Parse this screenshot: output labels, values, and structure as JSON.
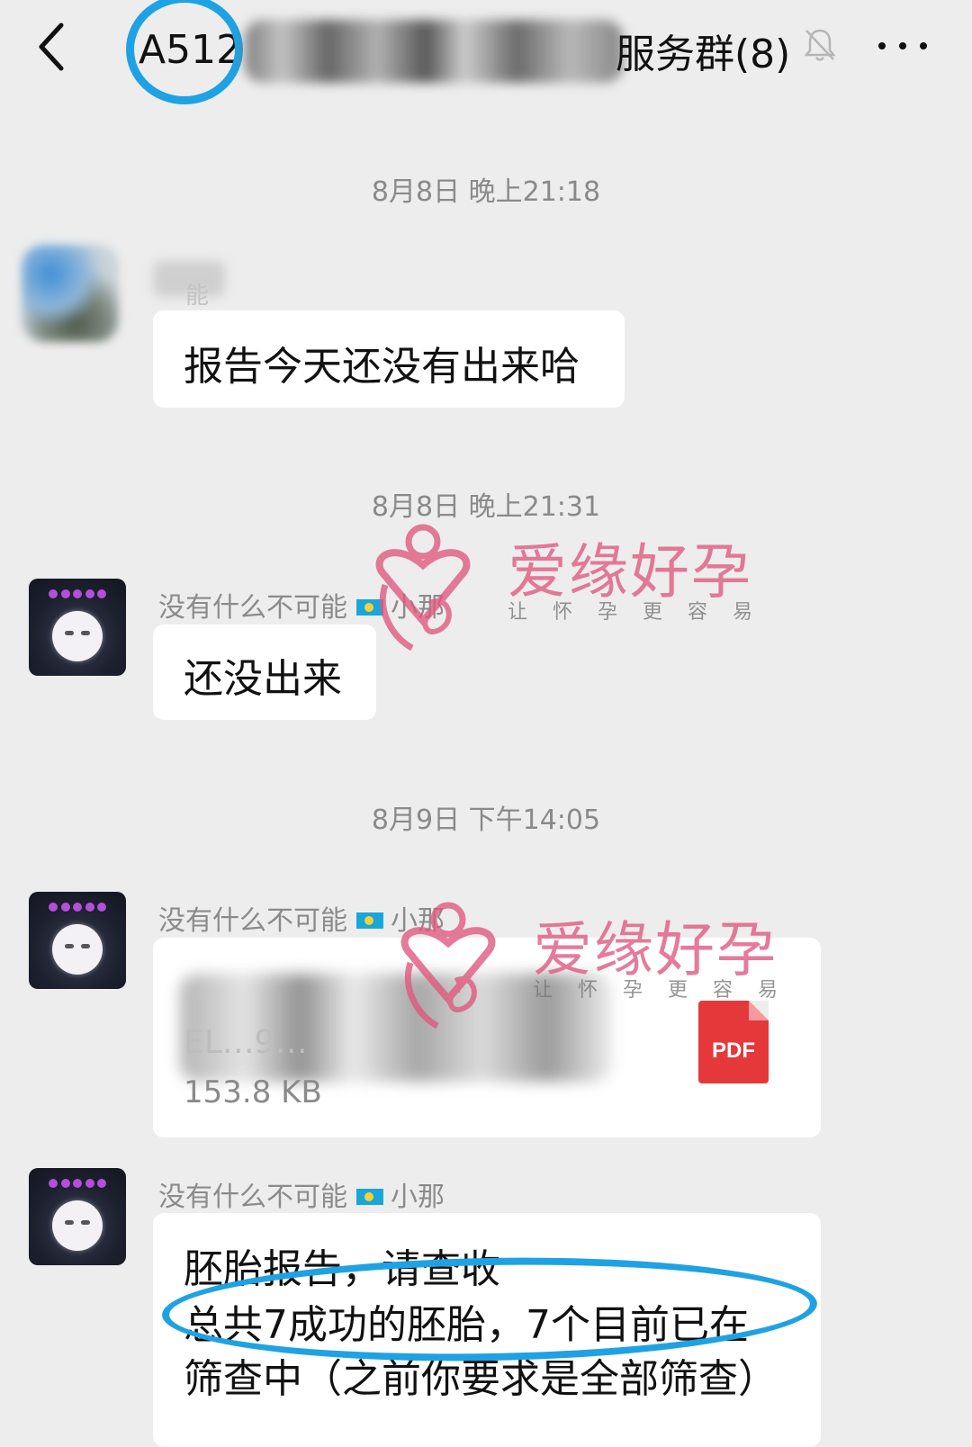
{
  "header": {
    "title_prefix": "A512",
    "title_suffix": "服务群(8)",
    "back_icon": "chevron-left-icon",
    "mute_icon": "bell-off-icon",
    "more_icon": "more-dots-icon"
  },
  "timestamps": [
    "8月8日 晚上21:18",
    "8月8日 晚上21:31",
    "8月9日 下午14:05"
  ],
  "messages": [
    {
      "sender_visible": "能",
      "text": "报告今天还没有出来哈"
    },
    {
      "sender": "没有什么不可能",
      "sender_suffix": "小那",
      "text": "还没出来"
    },
    {
      "sender": "没有什么不可能",
      "sender_suffix": "小那",
      "file": {
        "name": "EL…9…",
        "size": "153.8 KB",
        "type": "PDF"
      }
    },
    {
      "sender": "没有什么不可能",
      "sender_suffix": "小那",
      "lines": [
        "胚胎报告，请查收",
        "总共7成功的胚胎，7个目前已在",
        "筛查中（之前你要求是全部筛查）"
      ]
    }
  ],
  "watermark": {
    "brand": "爱缘好孕",
    "slogan": "让怀孕更容易"
  },
  "colors": {
    "background": "#ededed",
    "bubble": "#ffffff",
    "highlight": "#1fa2e3",
    "pdf": "#e5383b",
    "watermark": "#e0567e"
  }
}
